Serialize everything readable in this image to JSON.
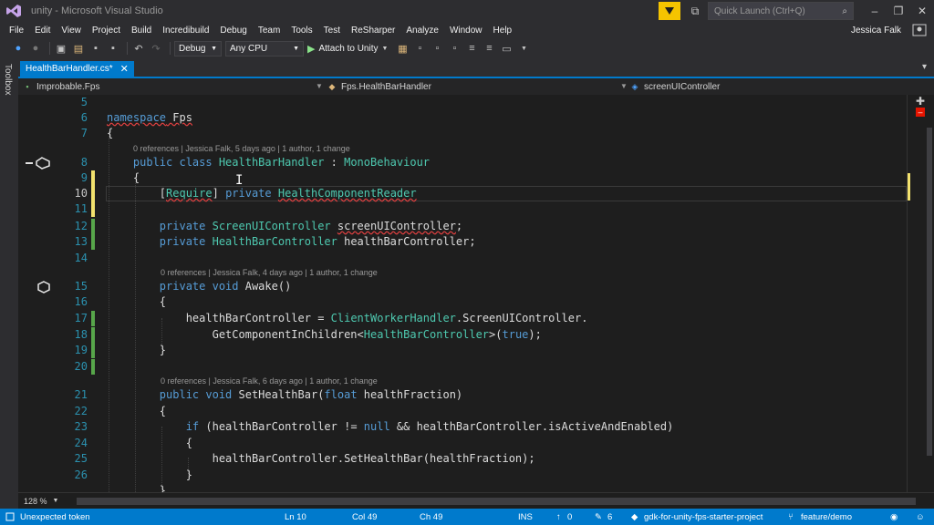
{
  "titlebar": {
    "app_title": "unity - Microsoft Visual Studio",
    "quick_launch_placeholder": "Quick Launch (Ctrl+Q)"
  },
  "menu": {
    "items": [
      "File",
      "Edit",
      "View",
      "Project",
      "Build",
      "Incredibuild",
      "Debug",
      "Team",
      "Tools",
      "Test",
      "ReSharper",
      "Analyze",
      "Window",
      "Help"
    ],
    "user": "Jessica Falk"
  },
  "toolbar": {
    "configuration": "Debug",
    "platform": "Any CPU",
    "attach_label": "Attach to Unity"
  },
  "toolbox_label": "Toolbox",
  "tabs": {
    "active_file": "HealthBarHandler.cs*"
  },
  "navbar": {
    "project": "Improbable.Fps",
    "type": "Fps.HealthBarHandler",
    "member": "screenUIController"
  },
  "lens": {
    "class": "0 references | Jessica Falk, 5 days ago | 1 author, 1 change",
    "awake": "0 references | Jessica Falk, 4 days ago | 1 author, 1 change",
    "sethealth": "0 references | Jessica Falk, 6 days ago | 1 author, 1 change"
  },
  "code": {
    "l5": "",
    "l6a": "namespace",
    "l6b": " Fps",
    "l7": "{",
    "l8a": "    public class ",
    "l8b": "HealthBarHandler",
    "l8c": " : ",
    "l8d": "MonoBehaviour",
    "l9": "    {",
    "l10a": "        [",
    "l10b": "Require",
    "l10c": "] ",
    "l10d": "private",
    "l10e": " ",
    "l10f": "HealthComponentReader",
    "l11": "",
    "l12a": "        private ",
    "l12b": "ScreenUIController",
    "l12c": " ",
    "l12d": "screenUIController",
    "l12e": ";",
    "l13a": "        private ",
    "l13b": "HealthBarController",
    "l13c": " healthBarController;",
    "l14": "",
    "l15a": "        private void ",
    "l15b": "Awake()",
    "l16": "        {",
    "l17a": "            healthBarController = ",
    "l17b": "ClientWorkerHandler",
    "l17c": ".ScreenUIController.",
    "l18a": "                GetComponentInChildren<",
    "l18b": "HealthBarController",
    "l18c": ">(",
    "l18d": "true",
    "l18e": ");",
    "l19": "        }",
    "l20": "",
    "l21a": "        public void ",
    "l21b": "SetHealthBar(",
    "l21c": "float",
    "l21d": " healthFraction)",
    "l22": "        {",
    "l23a": "            if",
    "l23b": " (healthBarController != ",
    "l23c": "null",
    "l23d": " && healthBarController.isActiveAndEnabled)",
    "l24": "            {",
    "l25": "                healthBarController.SetHealthBar(healthFraction);",
    "l26": "            }",
    "l27": "        }"
  },
  "line_numbers": [
    "5",
    "6",
    "7",
    "8",
    "9",
    "10",
    "11",
    "12",
    "13",
    "14",
    "15",
    "16",
    "17",
    "18",
    "19",
    "20",
    "21",
    "22",
    "23",
    "24",
    "25",
    "26"
  ],
  "zoom": "128 %",
  "statusbar": {
    "message": "Unexpected token",
    "ln": "Ln 10",
    "col": "Col 49",
    "ch": "Ch 49",
    "mode": "INS",
    "up_count": "0",
    "pencil_count": "6",
    "repo": "gdk-for-unity-fps-starter-project",
    "branch": "feature/demo"
  },
  "colors": {
    "accent": "#007acc",
    "keyword": "#569cd6",
    "type": "#4ec9b0",
    "change_bar": "#57a64a",
    "notification": "#f5c400"
  }
}
